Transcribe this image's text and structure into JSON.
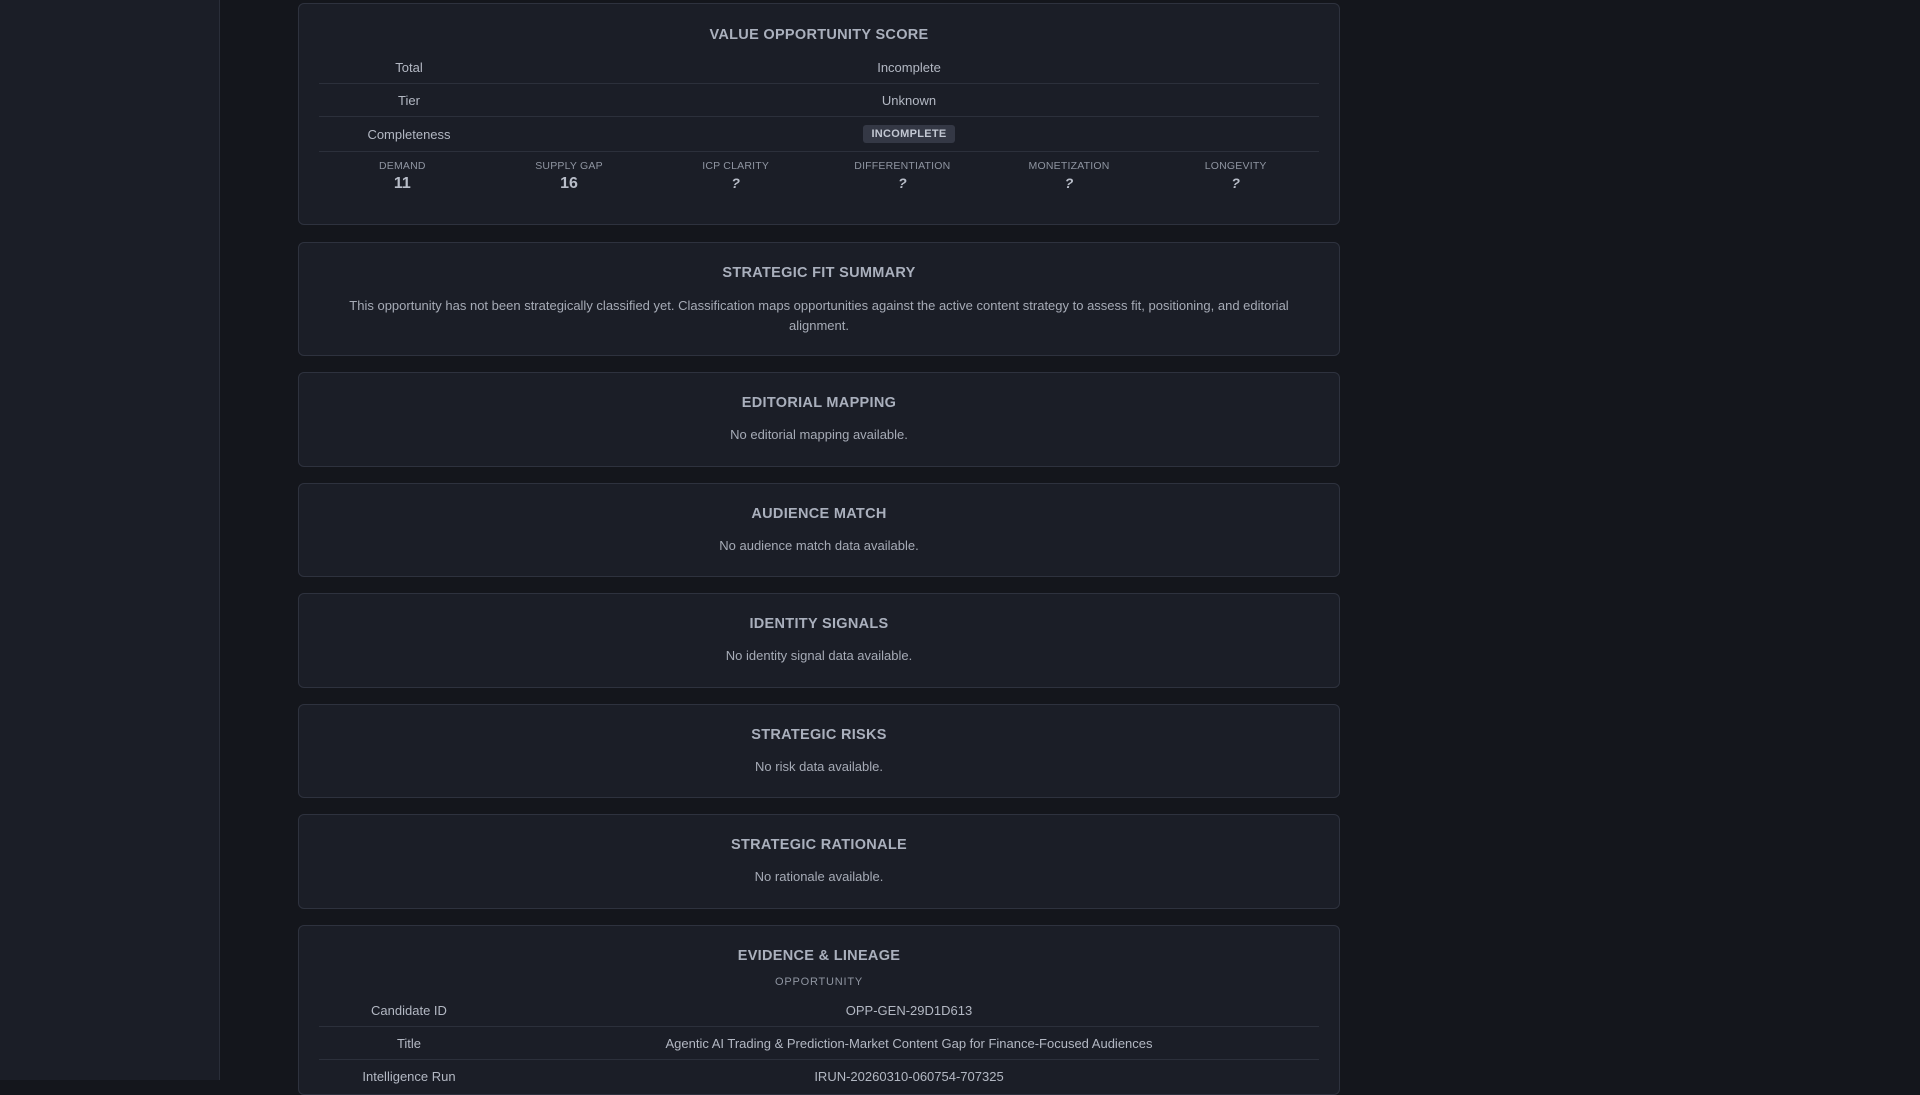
{
  "value_score": {
    "title": "VALUE OPPORTUNITY SCORE",
    "rows": [
      {
        "key": "Total",
        "value": "Incomplete"
      },
      {
        "key": "Tier",
        "value": "Unknown"
      },
      {
        "key": "Completeness",
        "value": "INCOMPLETE"
      }
    ],
    "metrics": [
      {
        "label": "DEMAND",
        "value": "11"
      },
      {
        "label": "SUPPLY GAP",
        "value": "16"
      },
      {
        "label": "ICP CLARITY",
        "value": "?"
      },
      {
        "label": "DIFFERENTIATION",
        "value": "?"
      },
      {
        "label": "MONETIZATION",
        "value": "?"
      },
      {
        "label": "LONGEVITY",
        "value": "?"
      }
    ]
  },
  "strategic_fit": {
    "title": "STRATEGIC FIT SUMMARY",
    "text": "This opportunity has not been strategically classified yet. Classification maps opportunities against the active content strategy to assess fit, positioning, and editorial alignment."
  },
  "editorial_mapping": {
    "title": "EDITORIAL MAPPING",
    "text": "No editorial mapping available."
  },
  "audience_match": {
    "title": "AUDIENCE MATCH",
    "text": "No audience match data available."
  },
  "identity_signals": {
    "title": "IDENTITY SIGNALS",
    "text": "No identity signal data available."
  },
  "strategic_risks": {
    "title": "STRATEGIC RISKS",
    "text": "No risk data available."
  },
  "strategic_rationale": {
    "title": "STRATEGIC RATIONALE",
    "text": "No rationale available."
  },
  "evidence": {
    "title": "EVIDENCE & LINEAGE",
    "section": "OPPORTUNITY",
    "rows": [
      {
        "key": "Candidate ID",
        "value": "OPP-GEN-29D1D613"
      },
      {
        "key": "Title",
        "value": "Agentic AI Trading & Prediction-Market Content Gap for Finance-Focused Audiences"
      },
      {
        "key": "Intelligence Run",
        "value": "IRUN-20260310-060754-707325"
      }
    ]
  },
  "colors": {
    "background": "#14161c",
    "card": "#1b1e27",
    "border": "#2e323e"
  }
}
